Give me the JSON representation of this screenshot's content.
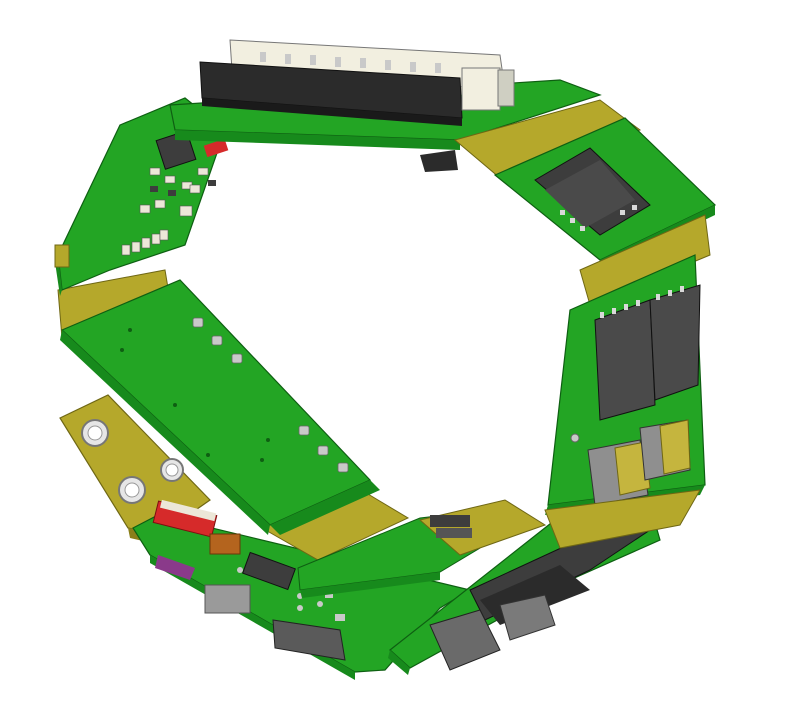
{
  "image": {
    "kind": "3D CAD render of a flexible-rigid PCB assembly folded into a ring",
    "background_color": "#ffffff"
  },
  "colors": {
    "pcb_green": "#23a524",
    "pcb_green_dark": "#178a1c",
    "pcb_edge": "#0e5f12",
    "flex_polyimide": "#b5a82b",
    "flex_dark": "#8a7f1a",
    "ic_body": "#3d3d3d",
    "ic_pin": "#d9d9d9",
    "connector_white": "#f2efe0",
    "connector_black": "#2b2b2b",
    "resistor_red": "#d62a2a",
    "capacitor_brown": "#b4641e",
    "via_silver": "#c9c9c9",
    "tab_purple": "#8a3a8a"
  },
  "icons": [
    "fpc-connector-icon",
    "ic-chip-icon",
    "mounting-hole-icon",
    "smd-resistor-icon",
    "smd-capacitor-icon"
  ]
}
